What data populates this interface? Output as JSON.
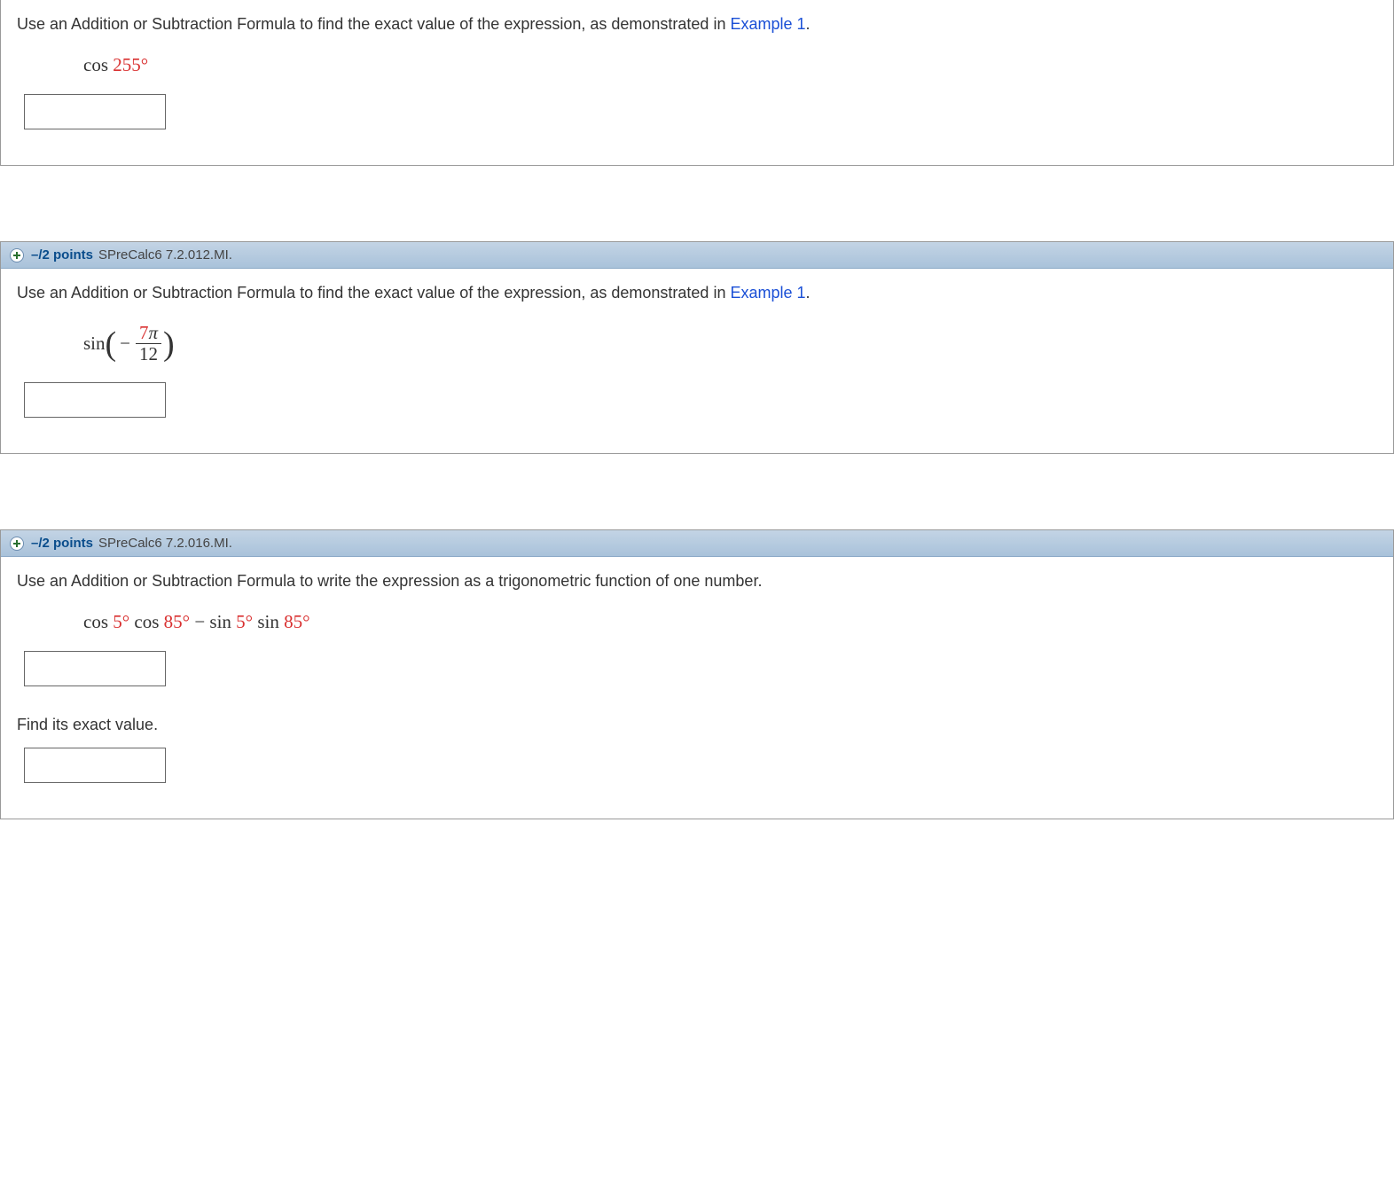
{
  "question1": {
    "instruction_pre": "Use an Addition or Subtraction Formula to find the exact value of the expression, as demonstrated in ",
    "example_link": "Example 1",
    "instruction_post": ".",
    "expr_prefix": "cos ",
    "expr_value": "255°"
  },
  "question2": {
    "points": "–/2 points",
    "id": "SPreCalc6 7.2.012.MI.",
    "instruction_pre": "Use an Addition or Subtraction Formula to find the exact value of the expression, as demonstrated in ",
    "example_link": "Example 1",
    "instruction_post": ".",
    "sin_label": "sin",
    "minus": "−",
    "frac_num_coef": "7",
    "frac_num_pi": "π",
    "frac_den": "12"
  },
  "question3": {
    "points": "–/2 points",
    "id": "SPreCalc6 7.2.016.MI.",
    "instruction": "Use an Addition or Subtraction Formula to write the expression as a trigonometric function of one number.",
    "expr_t1a": "cos ",
    "expr_t1b": "5°",
    "expr_t2a": " cos ",
    "expr_t2b": "85°",
    "expr_minus": " − ",
    "expr_t3a": "sin ",
    "expr_t3b": "5°",
    "expr_t4a": " sin ",
    "expr_t4b": "85°",
    "sub_instruction": "Find its exact value."
  }
}
